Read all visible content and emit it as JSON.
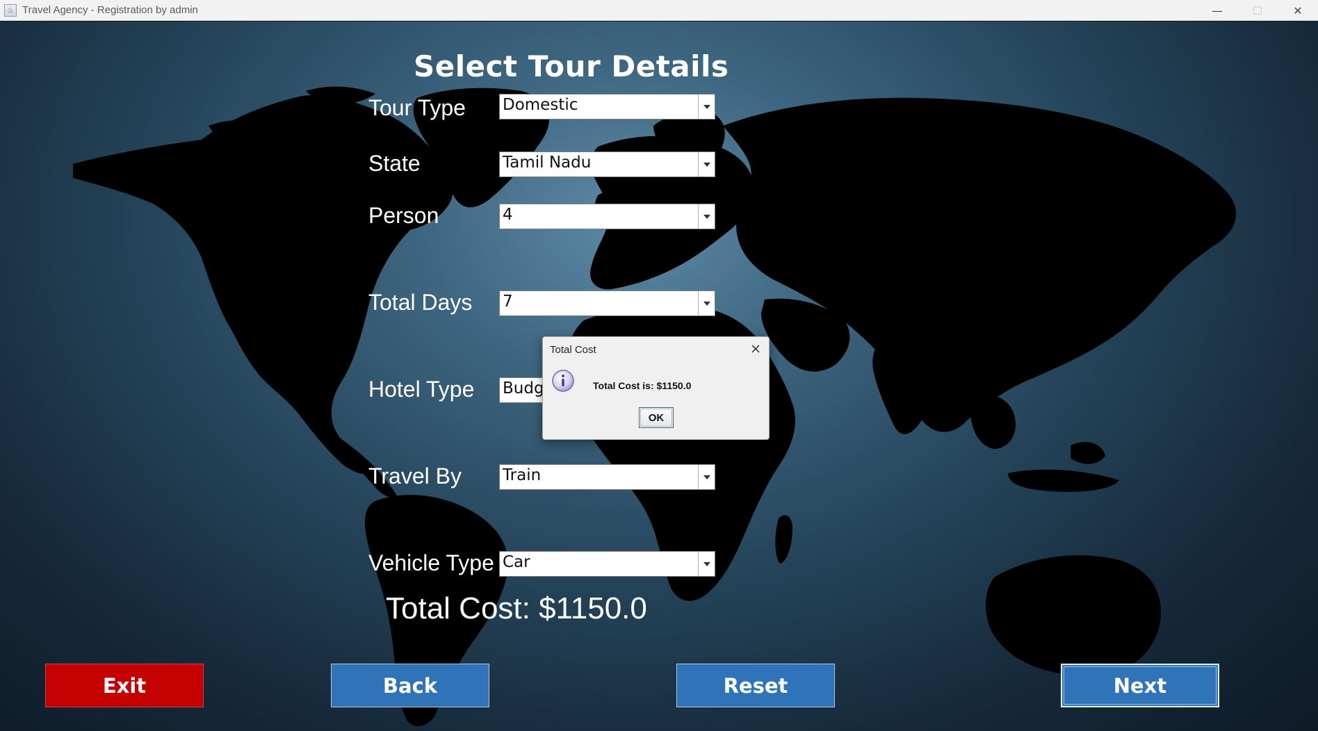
{
  "window": {
    "title": "Travel Agency - Registration by admin",
    "minimize": "—",
    "maximize": "☐",
    "close": "✕"
  },
  "heading": "Select Tour Details",
  "fields": {
    "tour_type": {
      "label": "Tour Type",
      "value": "Domestic"
    },
    "state": {
      "label": "State",
      "value": "Tamil Nadu"
    },
    "person": {
      "label": "Person",
      "value": "4"
    },
    "total_days": {
      "label": "Total Days",
      "value": "7"
    },
    "hotel_type": {
      "label": "Hotel Type",
      "value": "Budget"
    },
    "travel_by": {
      "label": "Travel By",
      "value": "Train"
    },
    "vehicle_type": {
      "label": "Vehicle Type",
      "value": "Car"
    }
  },
  "total_cost": "Total Cost: $1150.0",
  "buttons": {
    "exit": "Exit",
    "back": "Back",
    "reset": "Reset",
    "next": "Next"
  },
  "dialog": {
    "title": "Total Cost",
    "message": "Total Cost is: $1150.0",
    "ok": "OK"
  },
  "colors": {
    "exit_button": "#c40000",
    "primary_button": "#2f74b8",
    "map_land": "#000000"
  }
}
